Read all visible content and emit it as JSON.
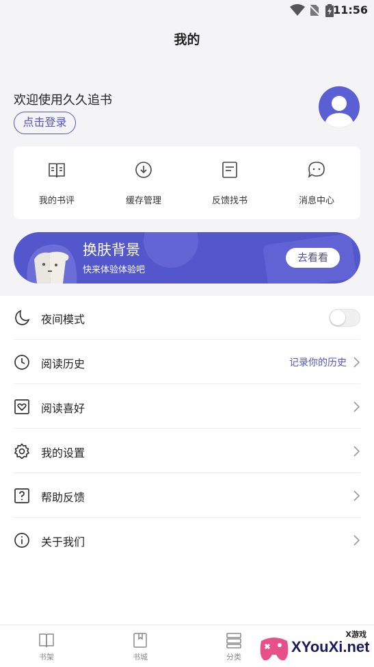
{
  "status_bar": {
    "time": "11:56",
    "icons": [
      "wifi-icon",
      "no-sim-icon",
      "battery-icon"
    ]
  },
  "page": {
    "title": "我的"
  },
  "profile": {
    "welcome": "欢迎使用久久追书",
    "login_label": "点击登录",
    "avatar_icon": "user-avatar-icon"
  },
  "shortcuts": [
    {
      "label": "我的书评",
      "icon": "book-review-icon"
    },
    {
      "label": "缓存管理",
      "icon": "download-icon"
    },
    {
      "label": "反馈找书",
      "icon": "document-icon"
    },
    {
      "label": "消息中心",
      "icon": "chat-bubble-icon"
    }
  ],
  "banner": {
    "title": "换肤背景",
    "subtitle": "快来体验体验吧",
    "button": "去看看",
    "color": "#5456cc"
  },
  "menu": [
    {
      "label": "夜间模式",
      "icon": "moon-icon",
      "toggle": true,
      "enabled": false
    },
    {
      "label": "阅读历史",
      "icon": "clock-icon",
      "hint": "记录你的历史"
    },
    {
      "label": "阅读喜好",
      "icon": "heart-box-icon"
    },
    {
      "label": "我的设置",
      "icon": "gear-icon"
    },
    {
      "label": "帮助反馈",
      "icon": "question-icon"
    },
    {
      "label": "关于我们",
      "icon": "info-icon"
    }
  ],
  "tabs": [
    {
      "label": "书架",
      "icon": "bookshelf-icon"
    },
    {
      "label": "书城",
      "icon": "bookstore-icon"
    },
    {
      "label": "分类",
      "icon": "category-icon"
    }
  ],
  "watermark": {
    "small": "X游戏",
    "big": "XYouXi.net"
  },
  "colors": {
    "accent": "#5254c4",
    "background": "#f4f4f6"
  }
}
